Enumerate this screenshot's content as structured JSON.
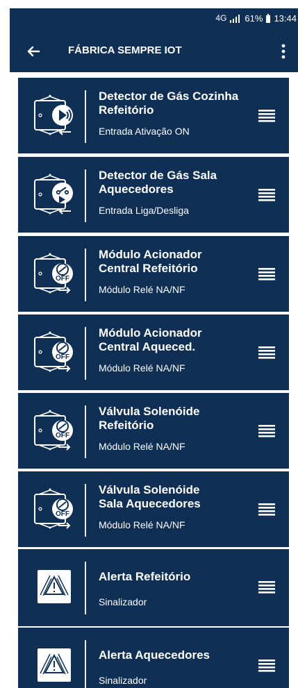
{
  "status_bar": {
    "network": "4G",
    "signal_icon": "signal-icon",
    "battery_percent": "61%",
    "battery_icon": "battery-icon",
    "time": "13:44"
  },
  "header": {
    "back_icon": "arrow-left-icon",
    "title": "FÁBRICA SEMPRE IOT",
    "menu_icon": "vertical-dots-icon",
    "background_color": "#0f2f55"
  },
  "devices": [
    {
      "title": "Detector de Gás Cozinha\nRefeitório",
      "subtitle": "Entrada Ativação ON",
      "icon": "gas-detector-input-on-icon"
    },
    {
      "title": "Detector de Gás Sala\nAquecedores",
      "subtitle": "Entrada Liga/Desliga",
      "icon": "gas-detector-onoff-input-icon"
    },
    {
      "title": "Módulo Acionador\nCentral Refeitório",
      "subtitle": "Módulo Relé NA/NF",
      "icon": "relay-off-output-icon"
    },
    {
      "title": "Módulo Acionador\nCentral Aqueced.",
      "subtitle": "Módulo Relé NA/NF",
      "icon": "relay-off-output-icon"
    },
    {
      "title": "Válvula Solenóide\nRefeitório",
      "subtitle": "Módulo Relé NA/NF",
      "icon": "relay-off-output-icon"
    },
    {
      "title": "Válvula Solenóide\nSala Aquecedores",
      "subtitle": "Módulo Relé NA/NF",
      "icon": "relay-off-output-icon"
    },
    {
      "title": "Alerta Refeitório",
      "subtitle": "Sinalizador",
      "icon": "alert-warning-icon"
    },
    {
      "title": "Alerta Aquecedores",
      "subtitle": "Sinalizador",
      "icon": "alert-warning-icon"
    }
  ],
  "list_action_icon": "hamburger-menu-icon",
  "colors": {
    "card_background": "#0f2f55",
    "text": "#ffffff"
  }
}
